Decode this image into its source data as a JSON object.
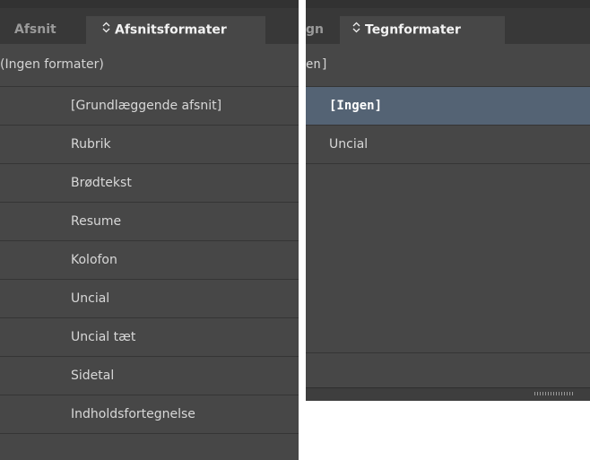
{
  "left_panel": {
    "tabs": [
      {
        "label": "Afsnit",
        "active": false
      },
      {
        "label": "Afsnitsformater",
        "active": true
      }
    ],
    "subheader": "(Ingen formater)",
    "styles": [
      "[Grundlæggende afsnit]",
      "Rubrik",
      "Brødtekst",
      "Resume",
      "Kolofon",
      "Uncial",
      "Uncial tæt",
      "Sidetal",
      "Indholdsfortegnelse"
    ]
  },
  "right_panel": {
    "tabs": [
      {
        "label": "gn",
        "active": false
      },
      {
        "label": "Tegnformater",
        "active": true
      }
    ],
    "subheader": "en]",
    "styles": [
      {
        "label": "[Ingen]",
        "selected": true
      },
      {
        "label": "Uncial",
        "selected": false
      }
    ]
  },
  "colors": {
    "panel_bg": "#474747",
    "tabbar_bg": "#383838",
    "selection": "#546374",
    "divider": "#353535"
  }
}
